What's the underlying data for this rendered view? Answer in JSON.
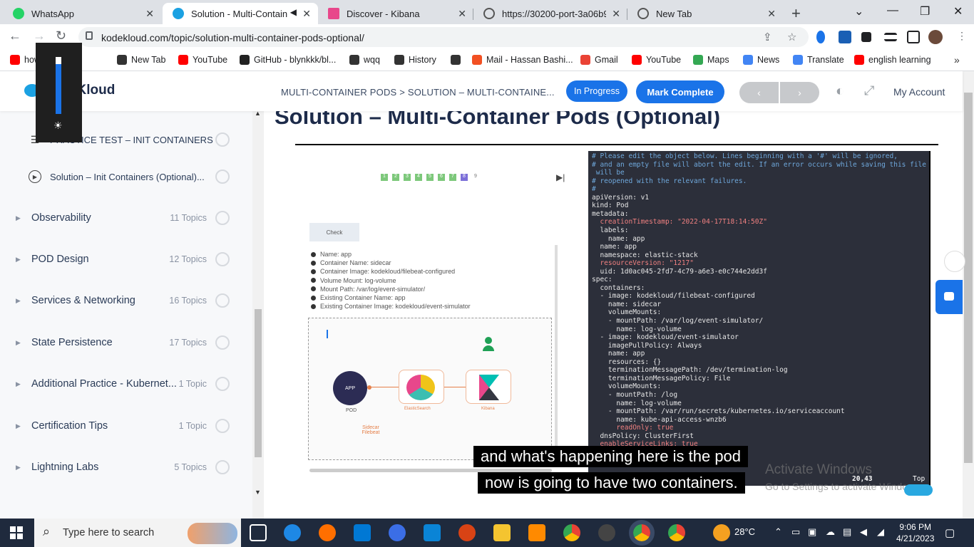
{
  "browser": {
    "tabs": [
      {
        "title": "WhatsApp",
        "active": false,
        "color": "#25d366"
      },
      {
        "title": "Solution - Multi-Contain",
        "active": true,
        "color": "#1ba1e2"
      },
      {
        "title": "Discover - Kibana",
        "active": false,
        "color": "#e8478b"
      },
      {
        "title": "https://30200-port-3a06b9e",
        "active": false,
        "color": "#555555"
      },
      {
        "title": "New Tab",
        "active": false,
        "color": "#555555"
      }
    ],
    "url": "kodekloud.com/topic/solution-multi-container-pods-optional/",
    "bookmarks": [
      {
        "label": "how ...urdu i...",
        "color": "#ff0000"
      },
      {
        "label": "New Tab",
        "color": "#333333"
      },
      {
        "label": "YouTube",
        "color": "#ff0000"
      },
      {
        "label": "GitHub - blynkkk/bl...",
        "color": "#222222"
      },
      {
        "label": "wqq",
        "color": "#333333"
      },
      {
        "label": "History",
        "color": "#333333"
      },
      {
        "label": "",
        "color": "#333333"
      },
      {
        "label": "Mail - Hassan Bashi...",
        "color": "#f25022"
      },
      {
        "label": "Gmail",
        "color": "#ea4335"
      },
      {
        "label": "YouTube",
        "color": "#ff0000"
      },
      {
        "label": "Maps",
        "color": "#34a853"
      },
      {
        "label": "News",
        "color": "#4285f4"
      },
      {
        "label": "Translate",
        "color": "#4285f4"
      },
      {
        "label": "english learning",
        "color": "#ff0000"
      }
    ]
  },
  "header": {
    "logo": "KodeKloud",
    "breadcrumb": "MULTI-CONTAINER PODS > SOLUTION – MULTI-CONTAINE...",
    "in_progress": "In Progress",
    "mark_complete": "Mark Complete",
    "prev": "‹",
    "next": "›",
    "account": "My Account"
  },
  "sidebar": {
    "sub_items": [
      {
        "label": "PRACTICE TEST – INIT CONTAINERS"
      },
      {
        "label": "Solution – Init Containers (Optional)..."
      }
    ],
    "sections": [
      {
        "label": "Observability",
        "count": "11 Topics"
      },
      {
        "label": "POD Design",
        "count": "12 Topics"
      },
      {
        "label": "Services & Networking",
        "count": "16 Topics"
      },
      {
        "label": "State Persistence",
        "count": "17 Topics"
      },
      {
        "label": "Additional Practice - Kubernet...",
        "count": "1 Topic"
      },
      {
        "label": "Certification Tips",
        "count": "1 Topic"
      },
      {
        "label": "Lightning Labs",
        "count": "5 Topics"
      }
    ]
  },
  "main": {
    "title": "Solution – Multi-Container Pods (Optional)"
  },
  "video": {
    "pages": [
      "1",
      "2",
      "3",
      "4",
      "5",
      "6",
      "7",
      "8",
      "9"
    ],
    "check": "Check",
    "bullets": [
      "Name: app",
      "Container Name: sidecar",
      "Container Image: kodekloud/filebeat-configured",
      "Volume Mount: log-volume",
      "Mount Path: /var/log/event-simulator/",
      "Existing Container Name: app",
      "Existing Container Image: kodekloud/event-simulator"
    ],
    "diagram": {
      "pod": "POD",
      "app": "APP",
      "es": "ElasticSearch",
      "kibana": "Kibana",
      "sidecar": "Sidecar Filebeat"
    },
    "terminal_lines": [
      "# Please edit the object below. Lines beginning with a '#' will be ignored,",
      "# and an empty file will abort the edit. If an error occurs while saving this file",
      " will be",
      "# reopened with the relevant failures.",
      "#",
      "apiVersion: v1",
      "kind: Pod",
      "metadata:",
      "  creationTimestamp: \"2022-04-17T18:14:50Z\"",
      "  labels:",
      "    name: app",
      "  name: app",
      "  namespace: elastic-stack",
      "  resourceVersion: \"1217\"",
      "  uid: 1d0ac045-2fd7-4c79-a6e3-e0c744e2dd3f",
      "spec:",
      "  containers:",
      "  - image: kodekloud/filebeat-configured",
      "    name: sidecar",
      "    volumeMounts:",
      "    - mountPath: /var/log/event-simulator/",
      "      name: log-volume",
      "  - image: kodekloud/event-simulator",
      "    imagePullPolicy: Always",
      "    name: app",
      "    resources: {}",
      "    terminationMessagePath: /dev/termination-log",
      "    terminationMessagePolicy: File",
      "    volumeMounts:",
      "    - mountPath: /log",
      "      name: log-volume",
      "    - mountPath: /var/run/secrets/kubernetes.io/serviceaccount",
      "      name: kube-api-access-wnzb6",
      "      readOnly: true",
      "  dnsPolicy: ClusterFirst",
      "  enableServiceLinks: true"
    ],
    "term_status": "20,43",
    "term_top": "Top",
    "caption_line1": "and what's happening here is the pod",
    "caption_line2": "now is going to have two containers."
  },
  "watermark": {
    "line1": "Activate Windows",
    "line2": "Go to Settings to activate Windows."
  },
  "taskbar": {
    "search_placeholder": "Type here to search",
    "temperature": "28°C",
    "time": "9:06 PM",
    "date": "4/21/2023"
  }
}
